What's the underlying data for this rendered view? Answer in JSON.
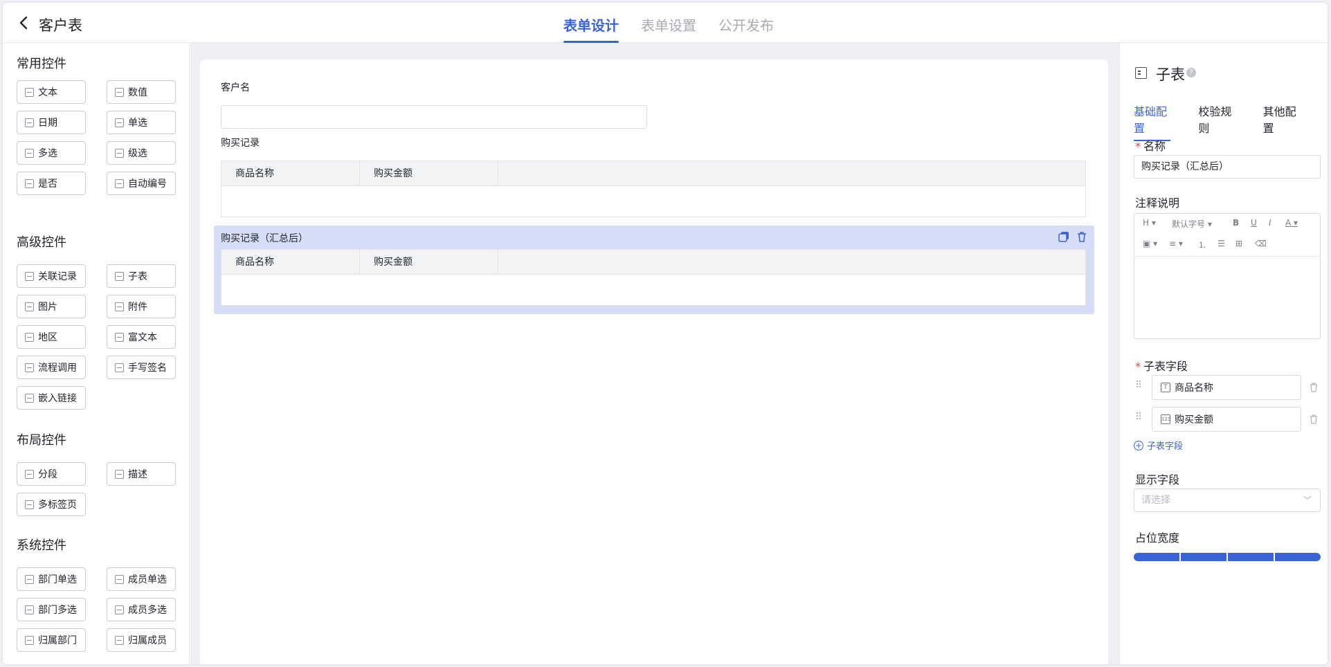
{
  "header": {
    "title": "客户表",
    "tabs": [
      {
        "label": "表单设计",
        "active": true
      },
      {
        "label": "表单设置"
      },
      {
        "label": "公开发布"
      }
    ]
  },
  "palette": {
    "groups": [
      {
        "title": "常用控件",
        "items": [
          "文本",
          "数值",
          "日期",
          "单选",
          "多选",
          "级选",
          "是否",
          "自动编号"
        ]
      },
      {
        "title": "高级控件",
        "items": [
          "关联记录",
          "子表",
          "图片",
          "附件",
          "地区",
          "富文本",
          "流程调用",
          "手写签名",
          "嵌入链接"
        ]
      },
      {
        "title": "布局控件",
        "items": [
          "分段",
          "描述",
          "多标签页"
        ]
      },
      {
        "title": "系统控件",
        "items": [
          "部门单选",
          "成员单选",
          "部门多选",
          "成员多选",
          "归属部门",
          "归属成员"
        ]
      }
    ]
  },
  "canvas": {
    "field1": {
      "label": "客户名",
      "value": ""
    },
    "field2": {
      "label": "购买记录",
      "columns": [
        "商品名称",
        "购买金额"
      ]
    },
    "field3": {
      "label": "购买记录（汇总后）",
      "columns": [
        "商品名称",
        "购买金额"
      ],
      "selected": true
    }
  },
  "panel": {
    "title": "子表",
    "help": "?",
    "tabs": [
      "基础配置",
      "校验规则",
      "其他配置"
    ],
    "name_label": "名称",
    "name_value": "购买记录（汇总后）",
    "note_label": "注释说明",
    "toolbar": {
      "heading": "H",
      "font_size": "默认字号",
      "bold": "B",
      "underline": "U",
      "italic": "I",
      "color": "A"
    },
    "subfields_label": "子表字段",
    "subfields": [
      {
        "label": "商品名称",
        "icon": "T"
      },
      {
        "label": "购买金额",
        "icon": "123"
      }
    ],
    "add_subfield": "子表字段",
    "display_label": "显示字段",
    "display_placeholder": "请选择",
    "width_label": "占位宽度",
    "width_fraction": 1.0,
    "accent": "#3a63d8"
  }
}
